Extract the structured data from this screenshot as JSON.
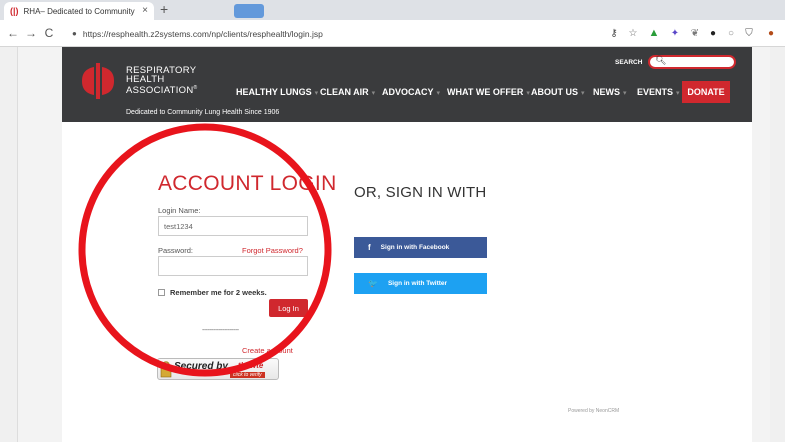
{
  "browser": {
    "tab_title": "RHA– Dedicated to Community",
    "tab_close": "×",
    "new_tab": "+",
    "url": "https://resphealth.z2systems.com/np/clients/resphealth/login.jsp",
    "nav": {
      "back": "←",
      "forward": "→",
      "reload": "C"
    },
    "lock": "🔒",
    "extensions": [
      "key-icon",
      "star-icon",
      "new-badge-icon",
      "dropbox-icon",
      "feather-icon",
      "ghost-icon",
      "circle-icon",
      "shield-icon",
      "profile-icon"
    ]
  },
  "site": {
    "logo_lines": [
      "RESPIRATORY",
      "HEALTH",
      "ASSOCIATION"
    ],
    "logo_mark": "®",
    "tagline": "Dedicated to Community Lung Health Since 1906",
    "search_label": "SEARCH",
    "nav_items": [
      {
        "label": "HEALTHY LUNGS",
        "caret": "▾"
      },
      {
        "label": "CLEAN AIR",
        "caret": "▾"
      },
      {
        "label": "ADVOCACY",
        "caret": "▾"
      },
      {
        "label": "WHAT WE OFFER",
        "caret": "▾"
      },
      {
        "label": "ABOUT US",
        "caret": "▾"
      },
      {
        "label": "NEWS",
        "caret": "▾"
      },
      {
        "label": "EVENTS",
        "caret": "▾"
      }
    ],
    "donate": "DONATE"
  },
  "login": {
    "title": "ACCOUNT LOGIN",
    "name_label": "Login Name:",
    "name_value": "test1234",
    "password_label": "Password:",
    "forgot": "Forgot Password?",
    "remember": "Remember me for 2 weeks.",
    "login_button": "Log In",
    "dashes": "--------------------",
    "create": "Create account",
    "thawte_secured": "Secured by",
    "thawte_brand": "thawte",
    "thawte_verify": "click to verify"
  },
  "social": {
    "title": "OR, SIGN IN WITH",
    "facebook": "Sign in with Facebook",
    "facebook_icon": "f",
    "twitter": "Sign in with Twitter",
    "twitter_icon": "🐦"
  },
  "footer": {
    "powered": "Powered by NeonCRM"
  },
  "colors": {
    "brand_red": "#d0282e",
    "header_dark": "#3a3b3d",
    "facebook": "#3b5998",
    "twitter": "#1da1f2",
    "annotation_circle": "#e8141c"
  }
}
